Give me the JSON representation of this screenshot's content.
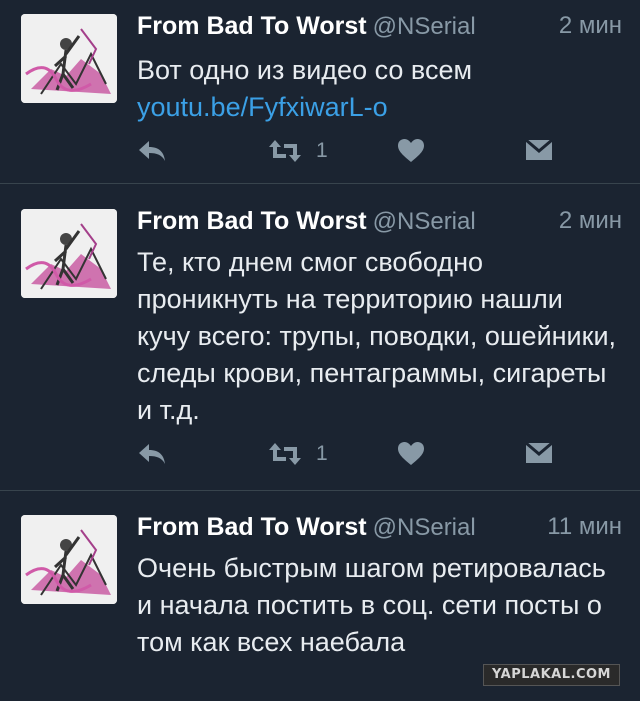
{
  "tweets": [
    {
      "name": "From Bad To Worst",
      "handle": "@NSerial",
      "time": "2 мин",
      "text": "Вот одно из видео со всем ",
      "link": "youtu.be/FyfxiwarL-o",
      "retweets": "1"
    },
    {
      "name": "From Bad To Worst",
      "handle": "@NSerial",
      "time": "2 мин",
      "text": "Те, кто днем смог свободно проникнуть на территорию нашли кучу всего: трупы, поводки, ошейники, следы крови, пентаграммы, сигареты и т.д.",
      "retweets": "1"
    },
    {
      "name": "From Bad To Worst",
      "handle": "@NSerial",
      "time": "11 мин",
      "text": "Очень быстрым шагом ретировалась и начала постить в соц. сети посты о том как всех наебала"
    }
  ],
  "watermark": "YAPLAKAL.COM",
  "icons": [
    "reply-icon",
    "retweet-icon",
    "like-icon",
    "direct-message-icon"
  ],
  "colors": {
    "background": "#1b2431",
    "link": "#3ba0e6",
    "muted": "#8899a6"
  }
}
